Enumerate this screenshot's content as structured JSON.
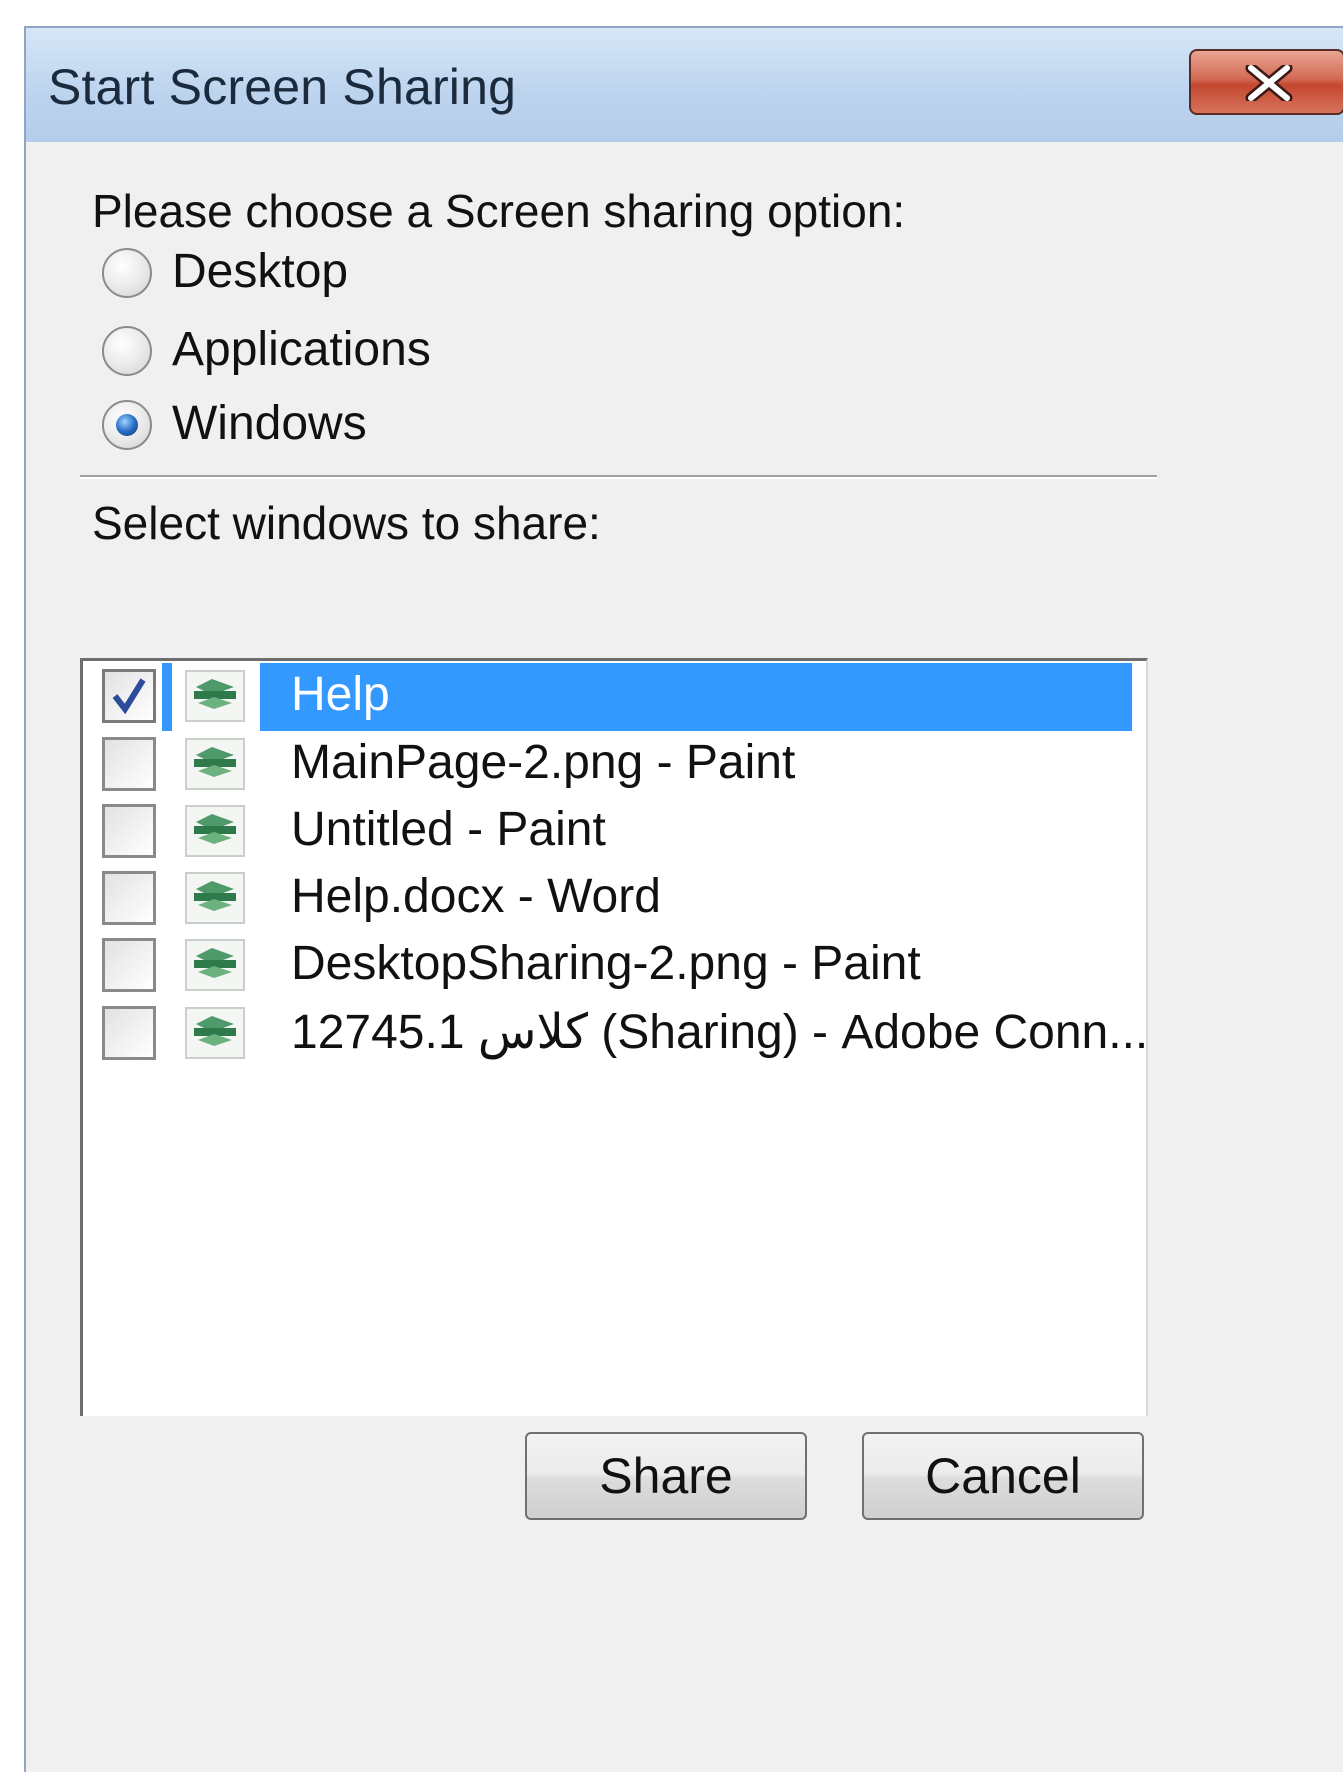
{
  "window": {
    "title": "Start Screen Sharing",
    "close_icon": "close-icon"
  },
  "options": {
    "prompt": "Please choose a Screen sharing option:",
    "radios": [
      {
        "label": "Desktop",
        "checked": false
      },
      {
        "label": "Applications",
        "checked": false
      },
      {
        "label": "Windows",
        "checked": true
      }
    ]
  },
  "windows_list": {
    "prompt": "Select windows to share:",
    "items": [
      {
        "label": "Help",
        "checked": true,
        "selected": true
      },
      {
        "label": "MainPage-2.png - Paint",
        "checked": false,
        "selected": false
      },
      {
        "label": "Untitled - Paint",
        "checked": false,
        "selected": false
      },
      {
        "label": "Help.docx - Word",
        "checked": false,
        "selected": false
      },
      {
        "label": "DesktopSharing-2.png - Paint",
        "checked": false,
        "selected": false
      },
      {
        "label": "12745.1 کلاس (Sharing) - Adobe Conn...",
        "checked": false,
        "selected": false
      }
    ],
    "item_icon": "application-window-icon",
    "selection_color": "#3399ff"
  },
  "buttons": {
    "share": "Share",
    "cancel": "Cancel"
  }
}
